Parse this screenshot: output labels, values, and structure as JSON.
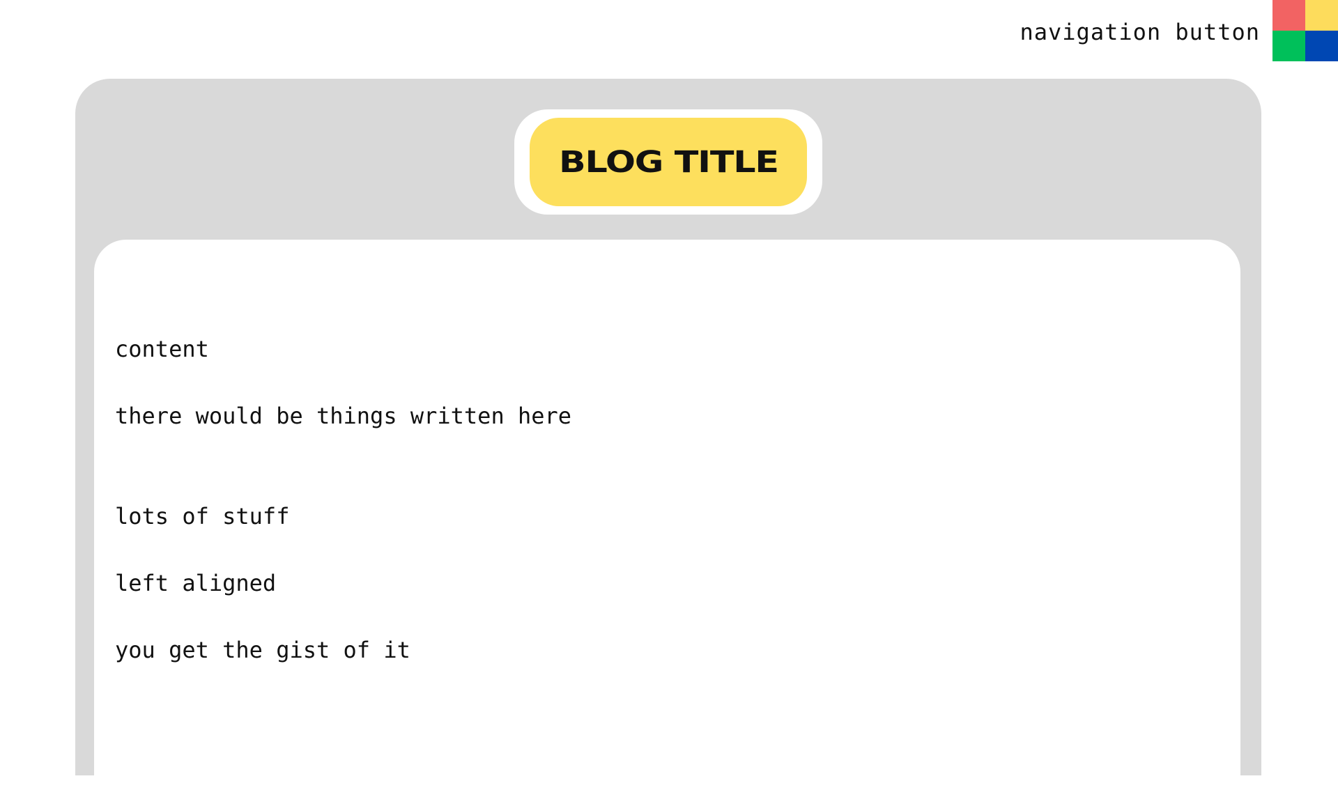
{
  "nav": {
    "label": "navigation button",
    "button_colors": [
      "#f26363",
      "#fddc5c",
      "#00c05a",
      "#0047b3"
    ]
  },
  "blog": {
    "title": "BLOG TITLE",
    "title_color": "#fddf5d",
    "content_lines": [
      "content",
      "there would be things written here",
      "lots of stuff",
      "left aligned",
      "you get the gist of it"
    ]
  }
}
